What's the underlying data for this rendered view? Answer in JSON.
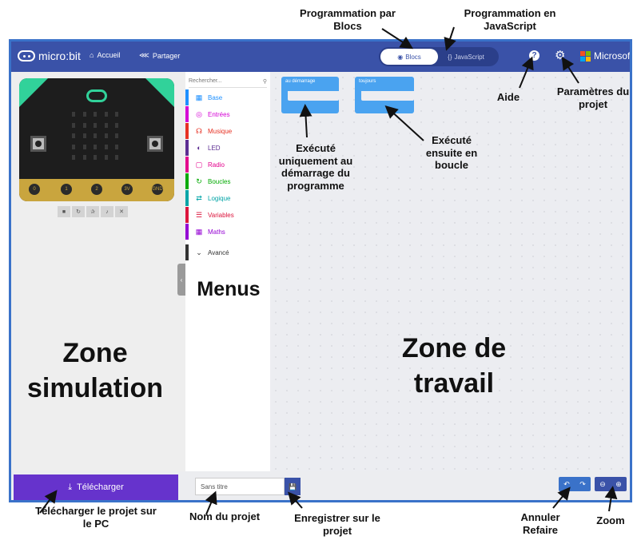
{
  "annotations": {
    "prog_blocs": "Programmation par Blocs",
    "prog_js": "Programmation en JavaScript",
    "aide": "Aide",
    "parametres": "Paramètres du projet",
    "execute_demarrage": "Exécuté uniquement au démarrage du programme",
    "execute_boucle": "Exécuté ensuite en boucle",
    "menus": "Menus",
    "zone_simulation": "Zone simulation",
    "zone_travail": "Zone de travail",
    "telecharger": "Télécharger le projet sur le PC",
    "nom": "Nom du projet",
    "enregistrer": "Enregistrer sur le projet",
    "annuler": "Annuler Refaire",
    "zoom": "Zoom"
  },
  "topbar": {
    "logo": "micro:bit",
    "home_label": "Accueil",
    "share_label": "Partager",
    "blocs_label": "Blocs",
    "js_label": "JavaScript",
    "microsoft_label": "Microsoft"
  },
  "toolbox": {
    "search_placeholder": "Rechercher...",
    "items": [
      {
        "label": "Base",
        "color": "#1e90ff",
        "icon": "grid-icon"
      },
      {
        "label": "Entrées",
        "color": "#d400d4",
        "icon": "input-icon"
      },
      {
        "label": "Musique",
        "color": "#e63022",
        "icon": "headphones-icon"
      },
      {
        "label": "LED",
        "color": "#5c2d91",
        "icon": "toggle-icon"
      },
      {
        "label": "Radio",
        "color": "#e3008c",
        "icon": "signal-icon"
      },
      {
        "label": "Boucles",
        "color": "#00aa00",
        "icon": "refresh-icon"
      },
      {
        "label": "Logique",
        "color": "#00a4a6",
        "icon": "shuffle-icon"
      },
      {
        "label": "Variables",
        "color": "#dc143c",
        "icon": "lines-icon"
      },
      {
        "label": "Maths",
        "color": "#9400d3",
        "icon": "calculator-icon"
      },
      {
        "label": "Avancé",
        "color": "#333333",
        "icon": "chevron-down-icon"
      }
    ]
  },
  "simulator": {
    "pins": [
      "0",
      "1",
      "2",
      "3V",
      "GND"
    ]
  },
  "workspace": {
    "block_start": "au démarrage",
    "block_forever": "toujours"
  },
  "bottombar": {
    "download_label": "Télécharger",
    "project_name_placeholder": "Sans titre"
  }
}
